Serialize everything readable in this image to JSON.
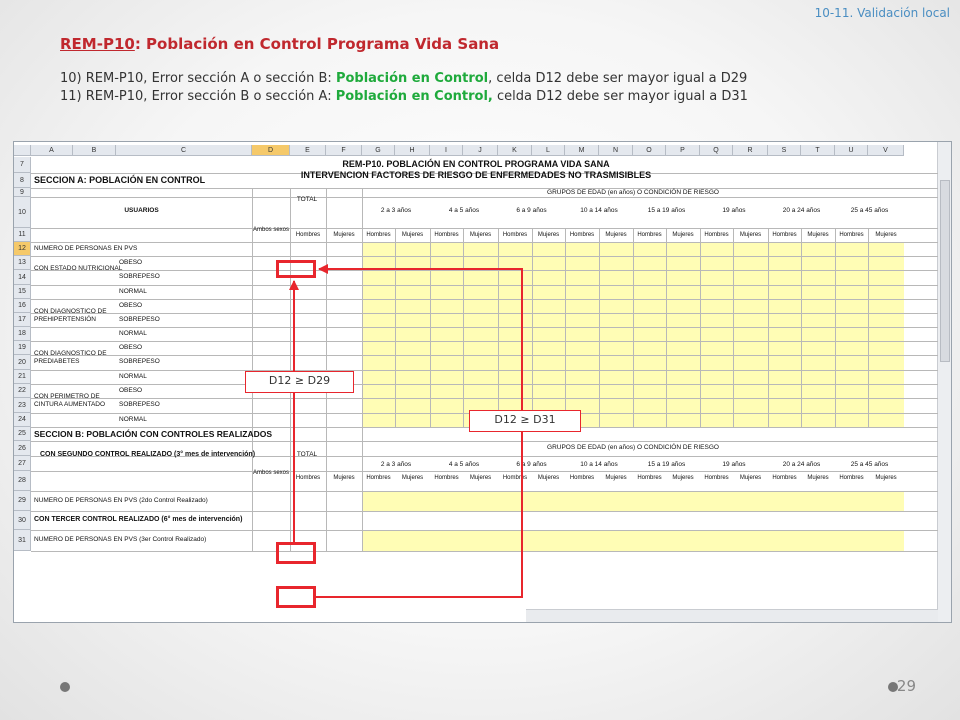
{
  "section_label": "10-11. Validación local",
  "title": {
    "code": "REM-P10",
    "rest": ": Población en Control Programa Vida Sana"
  },
  "rules": [
    {
      "num": "10)",
      "pre": "REM-P10, Error sección A o sección B: ",
      "hl": "Población en Control",
      "post": ", celda D12 debe ser mayor igual a D29"
    },
    {
      "num": "11)",
      "pre": "REM-P10, Error sección B o sección A: ",
      "hl": "Población en Control,",
      "post": " celda D12 debe ser mayor igual a D31"
    }
  ],
  "sheet": {
    "columns": [
      "A",
      "B",
      "C",
      "D",
      "E",
      "F",
      "G",
      "H",
      "I",
      "J",
      "K",
      "L",
      "M",
      "N",
      "O",
      "P",
      "Q",
      "R",
      "S",
      "T",
      "U",
      "V"
    ],
    "rows": [
      "7",
      "8",
      "9",
      "10",
      "11",
      "12",
      "13",
      "14",
      "15",
      "16",
      "17",
      "18",
      "19",
      "20",
      "21",
      "22",
      "23",
      "24",
      "25",
      "26",
      "27",
      "28",
      "29",
      "30",
      "31"
    ],
    "title1": "REM-P10.   POBLACIÓN EN CONTROL PROGRAMA VIDA SANA",
    "title2": "INTERVENCION FACTORES DE RIESGO DE ENFERMEDADES NO TRASMISIBLES",
    "section_a": "SECCION A: POBLACIÓN EN CONTROL",
    "section_b": "SECCION B: POBLACIÓN CON CONTROLES REALIZADOS",
    "usuarios": "USUARIOS",
    "total": "TOTAL",
    "grupos": "GRUPOS DE EDAD (en años) O CONDICIÓN DE RIESGO",
    "age_groups": [
      "2 a 3 años",
      "4 a 5 años",
      "6 a 9 años",
      "10 a 14 años",
      "15 a 19 años",
      "19 años",
      "20 a 24 años",
      "25 a 45 años"
    ],
    "ambos": "Ambos sexos",
    "hombres": "Hombres",
    "mujeres": "Mujeres",
    "num_personas": "NUMERO DE PERSONAS EN PVS",
    "estado_nutricional": "CON ESTADO NUTRICIONAL",
    "diag_hiper": "CON DIAGNOSTICO DE PREHIPERTENSIÓN",
    "diag_diab": "CON DIAGNOSTICO DE PREDIABETES",
    "perimetro": "CON PERIMETRO DE CINTURA AUMENTADO",
    "obeso": "OBESO",
    "sobrepeso": "SOBREPESO",
    "normal": "NORMAL",
    "segundo_control": "CON SEGUNDO CONTROL REALIZADO (3° mes de intervención)",
    "num_2do": "NUMERO DE PERSONAS EN PVS (2do Control Realizado)",
    "tercer_control": "CON TERCER CONTROL REALIZADO (6° mes de intervención)",
    "num_3er": "NUMERO DE PERSONAS EN PVS (3er Control Realizado)"
  },
  "callouts": {
    "d29": "D12  ≥  D29",
    "d31": "D12  ≥  D31"
  },
  "page_number": "29"
}
